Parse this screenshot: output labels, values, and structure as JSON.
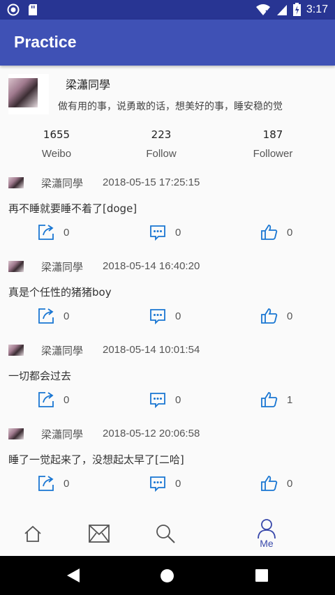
{
  "status_bar": {
    "time": "3:17",
    "icons": [
      "sync-icon",
      "sd-card-icon",
      "wifi-icon",
      "signal-icon",
      "battery-icon"
    ]
  },
  "app_bar": {
    "title": "Practice",
    "color": "#3f51b5"
  },
  "profile": {
    "name": "梁瀟同學",
    "bio": "做有用的事，说勇敢的话，想美好的事，睡安稳的觉"
  },
  "stats": [
    {
      "count": "1655",
      "label": "Weibo"
    },
    {
      "count": "223",
      "label": "Follow"
    },
    {
      "count": "187",
      "label": "Follower"
    }
  ],
  "posts": [
    {
      "author": "梁瀟同學",
      "time": "2018-05-15 17:25:15",
      "content": "再不睡就要睡不着了[doge]",
      "reposts": "0",
      "comments": "0",
      "likes": "0"
    },
    {
      "author": "梁瀟同學",
      "time": "2018-05-14 16:40:20",
      "content": "真是个任性的猪猪boy",
      "reposts": "0",
      "comments": "0",
      "likes": "0"
    },
    {
      "author": "梁瀟同學",
      "time": "2018-05-14 10:01:54",
      "content": "一切都会过去",
      "reposts": "0",
      "comments": "0",
      "likes": "1"
    },
    {
      "author": "梁瀟同學",
      "time": "2018-05-12 20:06:58",
      "content": "睡了一觉起来了，没想起太早了[二哈]",
      "reposts": "0",
      "comments": "0",
      "likes": "0"
    }
  ],
  "bottom_nav": {
    "items": [
      {
        "icon": "home-icon",
        "label": ""
      },
      {
        "icon": "message-icon",
        "label": ""
      },
      {
        "icon": "search-icon",
        "label": ""
      },
      {
        "icon": "profile-icon",
        "label": "Me"
      }
    ],
    "active_color": "#3949ab"
  },
  "accent_color": "#1976d2"
}
